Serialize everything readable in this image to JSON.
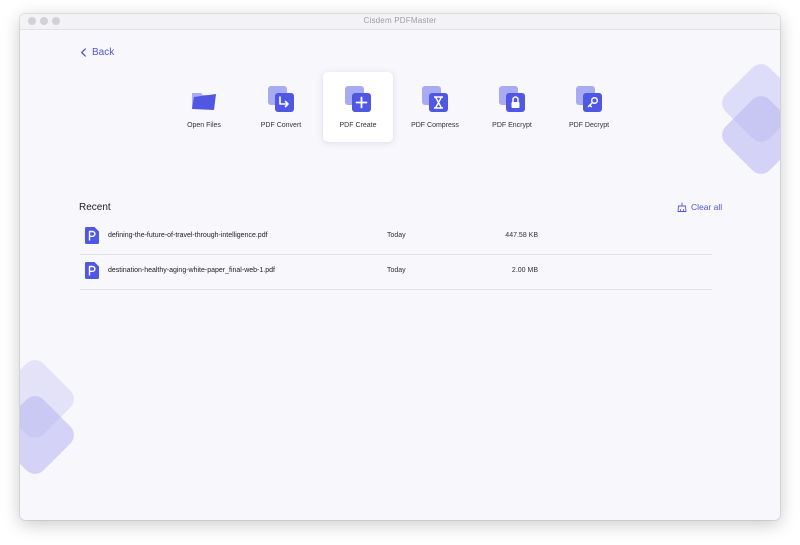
{
  "window": {
    "title": "Cisdem PDFMaster",
    "accent": "#4f55e0",
    "background": "#f8f7fc"
  },
  "nav": {
    "back_label": "Back"
  },
  "tools": [
    {
      "label": "Open Files",
      "icon": "folder-icon"
    },
    {
      "label": "PDF Convert",
      "icon": "convert-icon"
    },
    {
      "label": "PDF Create",
      "icon": "plus-icon",
      "selected": true
    },
    {
      "label": "PDF Compress",
      "icon": "compress-icon"
    },
    {
      "label": "PDF Encrypt",
      "icon": "lock-icon"
    },
    {
      "label": "PDF Decrypt",
      "icon": "key-icon"
    }
  ],
  "recent": {
    "title": "Recent",
    "clear_label": "Clear all",
    "files": [
      {
        "name": "defining-the-future-of-travel-through-intelligence.pdf",
        "date": "Today",
        "size": "447.58 KB"
      },
      {
        "name": "destination-healthy-aging-white-paper_final-web-1.pdf",
        "date": "Today",
        "size": "2.00 MB"
      }
    ]
  }
}
